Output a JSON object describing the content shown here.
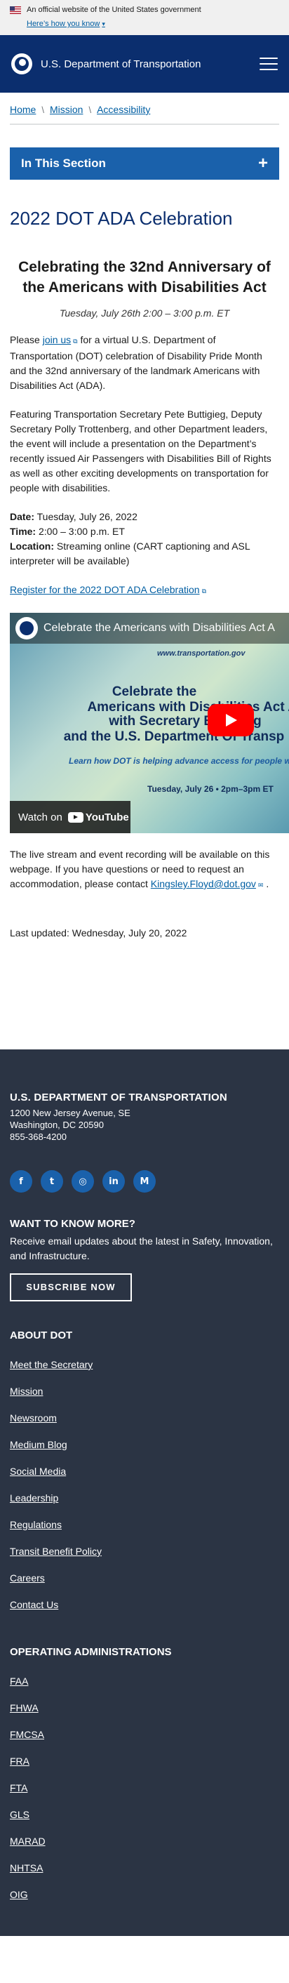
{
  "gov_banner": {
    "official_text": "An official website of the United States government",
    "how_know": "Here’s how you know"
  },
  "header": {
    "site_name": "U.S. Department of Transportation"
  },
  "breadcrumb": [
    "Home",
    "Mission",
    "Accessibility"
  ],
  "in_section": {
    "label": "In This Section"
  },
  "page": {
    "title": "2022 DOT ADA Celebration",
    "event_heading": "Celebrating the 32nd Anniversary of the Americans with Disabilities Act",
    "event_time": "Tuesday, July 26th 2:00 – 3:00 p.m. ET",
    "intro_before": "Please ",
    "intro_link": "join us",
    "intro_after": " for a virtual U.S. Department of Transportation (DOT) celebration of Disability Pride Month and the 32nd anniversary of the landmark Americans with Disabilities Act (ADA).",
    "featuring": "Featuring Transportation Secretary Pete Buttigieg, Deputy Secretary Polly Trottenberg, and other Department leaders, the event will include a presentation on the Department’s recently issued Air Passengers with Disabilities Bill of Rights as well as other exciting developments on transportation for people with disabilities.",
    "date_label": "Date:",
    "date_value": " Tuesday, July 26, 2022",
    "time_label": "Time:",
    "time_value": " 2:00 – 3:00 p.m. ET",
    "location_label": "Location:",
    "location_value": " Streaming online (CART captioning and ASL interpreter will be available)",
    "register_link": "Register for the 2022 DOT ADA Celebration",
    "closing_text": "The live stream and event recording will be available on this webpage. If you have questions or need to request an accommodation, please contact ",
    "contact_email": "Kingsley.Floyd@dot.gov",
    "closing_end": " .",
    "last_updated": "Last updated: Wednesday, July 20, 2022"
  },
  "video": {
    "title": "Celebrate the Americans with Disabilities Act A",
    "url_text": "www.transportation.gov",
    "line1": "Celebrate the",
    "line2": "Americans with Disabilities Act An",
    "line3": "with Secretary Buttigieg",
    "line4": "and the U.S. Department Of Transp",
    "subline": "Learn how DOT is helping advance access for people w",
    "dateline": "Tuesday, July 26 • 2pm–3pm ET",
    "watch_on": "Watch on",
    "youtube": "YouTube"
  },
  "footer": {
    "org": "U.S. DEPARTMENT OF TRANSPORTATION",
    "address1": "1200 New Jersey Avenue, SE",
    "address2": "Washington, DC 20590",
    "phone": "855-368-4200",
    "socials": [
      {
        "name": "facebook-icon",
        "glyph": "f"
      },
      {
        "name": "twitter-icon",
        "glyph": "t"
      },
      {
        "name": "instagram-icon",
        "glyph": "◎"
      },
      {
        "name": "linkedin-icon",
        "glyph": "in"
      },
      {
        "name": "medium-icon",
        "glyph": "M"
      }
    ],
    "want_title": "WANT TO KNOW MORE?",
    "want_desc": "Receive email updates about the latest in Safety, Innovation, and Infrastructure.",
    "subscribe": "SUBSCRIBE NOW",
    "about_title": "ABOUT DOT",
    "about_links": [
      "Meet the Secretary",
      "Mission",
      "Newsroom",
      "Medium Blog",
      "Social Media",
      "Leadership",
      "Regulations",
      "Transit Benefit Policy",
      "Careers",
      "Contact Us"
    ],
    "ops_title": "OPERATING ADMINISTRATIONS",
    "ops_links": [
      "FAA",
      "FHWA",
      "FMCSA",
      "FRA",
      "FTA",
      "GLS",
      "MARAD",
      "NHTSA",
      "OIG"
    ]
  },
  "colors": {
    "header_bg": "#0b2e6e",
    "section_bar": "#1a61ab",
    "link": "#005ea2",
    "footer_bg": "#2b3444",
    "youtube_red": "#ff0000"
  }
}
